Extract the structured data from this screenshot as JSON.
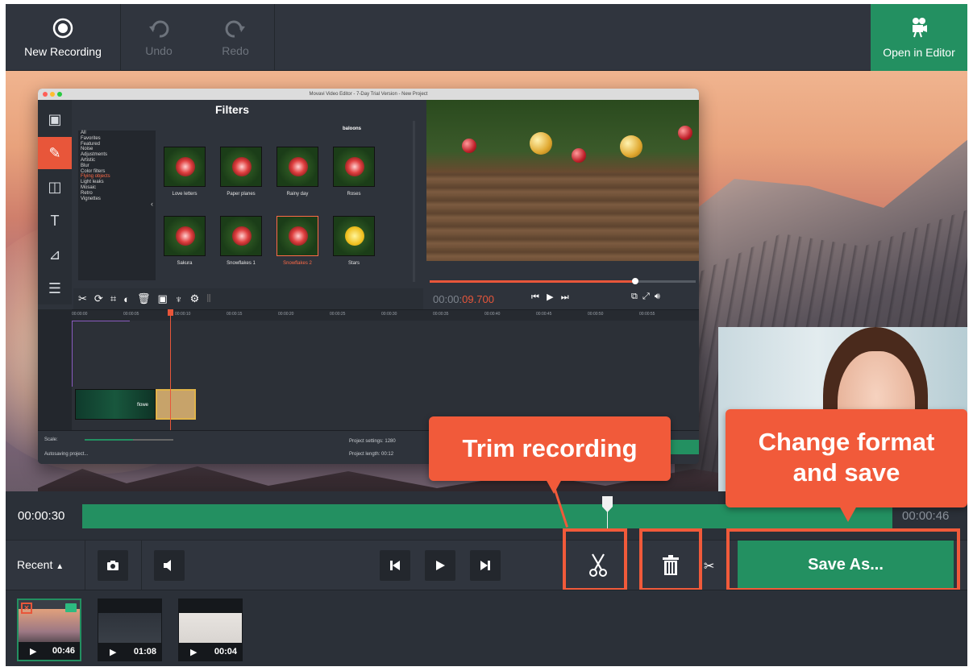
{
  "toolbar": {
    "new_recording": "New Recording",
    "undo": "Undo",
    "redo": "Redo",
    "open_in_editor": "Open in Editor"
  },
  "editor": {
    "window_title": "Movavi Video Editor - 7-Day Trial Version - New Project",
    "panel_title": "Filters",
    "column_hint": "baloons",
    "categories": [
      "All",
      "Favorites",
      "Featured",
      "Noise",
      "Adjustments",
      "Artistic",
      "Blur",
      "Color filters",
      "Flying objects",
      "Light leaks",
      "Mosaic",
      "Retro",
      "Vignettes"
    ],
    "selected_category": "Flying objects",
    "filters": [
      "Love letters",
      "Paper planes",
      "Rainy day",
      "Roses",
      "Sakura",
      "Snowflakes 1",
      "Snowflakes 2",
      "Stars"
    ],
    "selected_filter": "Snowflakes 2",
    "time_prefix": "00:00:",
    "time_red": "09.700",
    "ruler": [
      "00:00:00",
      "00:00:05",
      "00:00:10",
      "00:00:15",
      "00:00:20",
      "00:00:25",
      "00:00:30",
      "00:00:35",
      "00:00:40",
      "00:00:45",
      "00:00:50",
      "00:00:55"
    ],
    "clip_label": "flowe",
    "scale_label": "Scale:",
    "autosave": "Autosaving project...",
    "project_settings": "Project settings:  1280",
    "project_length": "Project length:  00:12"
  },
  "timeline": {
    "start": "00:00:30",
    "end": "00:00:46"
  },
  "controls": {
    "recent": "Recent",
    "save_as": "Save As..."
  },
  "recordings": [
    {
      "duration": "00:46"
    },
    {
      "duration": "01:08"
    },
    {
      "duration": "00:04"
    }
  ],
  "callouts": {
    "trim": "Trim recording",
    "save_line1": "Change format",
    "save_line2": "and save"
  },
  "colors": {
    "accent_green": "#239061",
    "accent_orange": "#f15a3a",
    "bg_dark": "#2b3038"
  }
}
